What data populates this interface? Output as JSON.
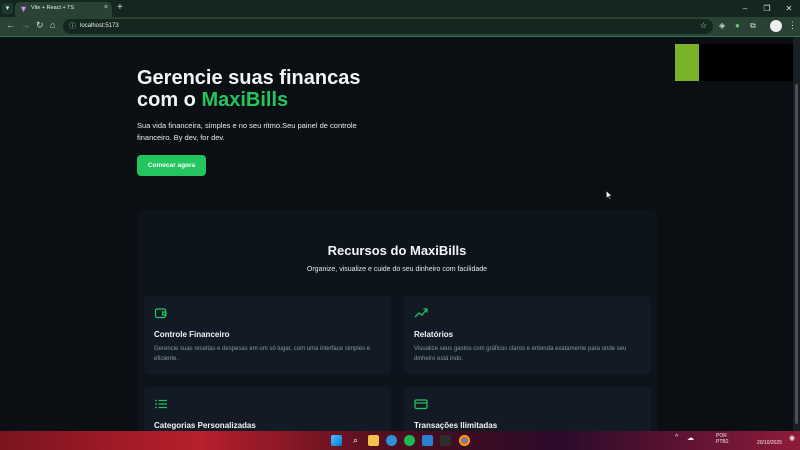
{
  "browser": {
    "tab_title": "Vite + React + TS",
    "url": "localhost:5173",
    "new_tab_symbol": "+",
    "tab_close_symbol": "×",
    "window_minimize": "–",
    "window_maximize": "❐",
    "window_close": "✕"
  },
  "hero": {
    "title_line1": "Gerencie suas financas",
    "title_line2_prefix": "com o ",
    "brand": "MaxiBills",
    "subtitle": "Sua vida financeira, simples e no seu ritmo.Seu painel de controle financeiro. By dev, for dev.",
    "cta_label": "Comecar agora"
  },
  "features": {
    "title": "Recursos do MaxiBills",
    "subtitle": "Organize, visualize e cuide do seu dinheiro com facilidade",
    "cards": [
      {
        "icon": "wallet-icon",
        "title": "Controle Financeiro",
        "desc": "Gerencie suas receitas e despesas em um só lugar, com uma interface simples e eficiente."
      },
      {
        "icon": "trending-up-icon",
        "title": "Relatórios",
        "desc": "Visualize seus gastos com gráficos claros e entenda exatamente para onde seu dinheiro está indo."
      },
      {
        "icon": "list-icon",
        "title": "Categorias Personalizadas",
        "desc": ""
      },
      {
        "icon": "credit-card-icon",
        "title": "Transações Ilimitadas",
        "desc": ""
      }
    ]
  },
  "taskbar": {
    "lang_line1": "POR",
    "lang_line2": "PTB2",
    "date": "20/10/2025"
  },
  "colors": {
    "accent": "#22c55e",
    "page_bg": "#0b0f14",
    "card_bg": "#121b25",
    "browser_frame": "#2a4236"
  }
}
